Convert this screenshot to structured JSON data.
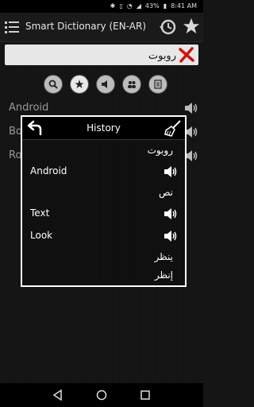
{
  "status_bar": {
    "battery": "43%",
    "time": "8:41 AM"
  },
  "app_bar": {
    "title": "Smart Dictionary (EN-AR)"
  },
  "search": {
    "value": "روبوت"
  },
  "mode_buttons": [
    "search-icon",
    "star-icon",
    "speaker-icon",
    "people-icon",
    "document-icon"
  ],
  "background_rows": [
    "Android",
    "Bo",
    "Ro"
  ],
  "dialog": {
    "title": "History",
    "entries": [
      {
        "word": "روبوت",
        "arabic": true,
        "speaker": false
      },
      {
        "word": "Android",
        "arabic": false,
        "speaker": true
      },
      {
        "word": "نص",
        "arabic": true,
        "speaker": false
      },
      {
        "word": "Text",
        "arabic": false,
        "speaker": true
      },
      {
        "word": "Look",
        "arabic": false,
        "speaker": true
      },
      {
        "word": "ينظر",
        "arabic": true,
        "speaker": false
      },
      {
        "word": "إنظر",
        "arabic": true,
        "speaker": false
      }
    ]
  },
  "colors": {
    "clear_icon": "#d11010",
    "appbar": "#1a1a1a",
    "dialog_border": "#ffffff"
  }
}
